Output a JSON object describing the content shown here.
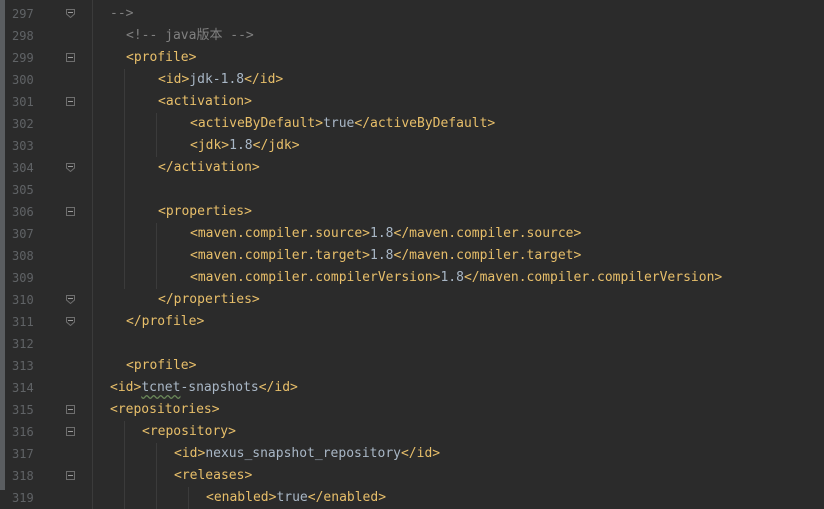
{
  "editor": {
    "lines": [
      {
        "num": "297",
        "parts": [
          {
            "t": "-->",
            "c": "cmt"
          }
        ],
        "indent": 110,
        "fold": "end"
      },
      {
        "num": "298",
        "parts": [
          {
            "t": "<!-- java版本 -->",
            "c": "cmt"
          }
        ],
        "indent": 126,
        "fold": ""
      },
      {
        "num": "299",
        "parts": [
          {
            "t": "<profile>",
            "c": "tag"
          }
        ],
        "indent": 126,
        "fold": "start"
      },
      {
        "num": "300",
        "parts": [
          {
            "t": "<id>",
            "c": "tag"
          },
          {
            "t": "jdk-1.8",
            "c": "txt"
          },
          {
            "t": "</id>",
            "c": "tag"
          }
        ],
        "indent": 158,
        "fold": ""
      },
      {
        "num": "301",
        "parts": [
          {
            "t": "<activation>",
            "c": "tag"
          }
        ],
        "indent": 158,
        "fold": "start"
      },
      {
        "num": "302",
        "parts": [
          {
            "t": "<activeByDefault>",
            "c": "tag"
          },
          {
            "t": "true",
            "c": "txt"
          },
          {
            "t": "</activeByDefault>",
            "c": "tag"
          }
        ],
        "indent": 190,
        "fold": ""
      },
      {
        "num": "303",
        "parts": [
          {
            "t": "<jdk>",
            "c": "tag"
          },
          {
            "t": "1.8",
            "c": "txt"
          },
          {
            "t": "</jdk>",
            "c": "tag"
          }
        ],
        "indent": 190,
        "fold": ""
      },
      {
        "num": "304",
        "parts": [
          {
            "t": "</activation>",
            "c": "tag"
          }
        ],
        "indent": 158,
        "fold": "end"
      },
      {
        "num": "305",
        "parts": [],
        "indent": 158,
        "fold": ""
      },
      {
        "num": "306",
        "parts": [
          {
            "t": "<properties>",
            "c": "tag"
          }
        ],
        "indent": 158,
        "fold": "start"
      },
      {
        "num": "307",
        "parts": [
          {
            "t": "<maven.compiler.source>",
            "c": "tag"
          },
          {
            "t": "1.8",
            "c": "txt"
          },
          {
            "t": "</maven.compiler.source>",
            "c": "tag"
          }
        ],
        "indent": 190,
        "fold": ""
      },
      {
        "num": "308",
        "parts": [
          {
            "t": "<maven.compiler.target>",
            "c": "tag"
          },
          {
            "t": "1.8",
            "c": "txt"
          },
          {
            "t": "</maven.compiler.target>",
            "c": "tag"
          }
        ],
        "indent": 190,
        "fold": ""
      },
      {
        "num": "309",
        "parts": [
          {
            "t": "<maven.compiler.compilerVersion>",
            "c": "tag"
          },
          {
            "t": "1.8",
            "c": "txt"
          },
          {
            "t": "</maven.compiler.compilerVersion>",
            "c": "tag"
          }
        ],
        "indent": 190,
        "fold": ""
      },
      {
        "num": "310",
        "parts": [
          {
            "t": "</properties>",
            "c": "tag"
          }
        ],
        "indent": 158,
        "fold": "end"
      },
      {
        "num": "311",
        "parts": [
          {
            "t": "</profile>",
            "c": "tag"
          }
        ],
        "indent": 126,
        "fold": "end"
      },
      {
        "num": "312",
        "parts": [],
        "indent": 126,
        "fold": ""
      },
      {
        "num": "313",
        "parts": [
          {
            "t": "<profile>",
            "c": "tag"
          }
        ],
        "indent": 126,
        "fold": ""
      },
      {
        "num": "314",
        "parts": [
          {
            "t": "<id>",
            "c": "tag"
          },
          {
            "t": "tcnet",
            "c": "txt squig"
          },
          {
            "t": "-snapshots",
            "c": "txt"
          },
          {
            "t": "</id>",
            "c": "tag"
          }
        ],
        "indent": 110,
        "fold": ""
      },
      {
        "num": "315",
        "parts": [
          {
            "t": "<repositories>",
            "c": "tag"
          }
        ],
        "indent": 110,
        "fold": "start"
      },
      {
        "num": "316",
        "parts": [
          {
            "t": "<repository>",
            "c": "tag"
          }
        ],
        "indent": 142,
        "fold": "start"
      },
      {
        "num": "317",
        "parts": [
          {
            "t": "<id>",
            "c": "tag"
          },
          {
            "t": "nexus_snapshot_repository",
            "c": "txt"
          },
          {
            "t": "</id>",
            "c": "tag"
          }
        ],
        "indent": 174,
        "fold": ""
      },
      {
        "num": "318",
        "parts": [
          {
            "t": "<releases>",
            "c": "tag"
          }
        ],
        "indent": 174,
        "fold": "start"
      },
      {
        "num": "319",
        "parts": [
          {
            "t": "<enabled>",
            "c": "tag"
          },
          {
            "t": "true",
            "c": "txt"
          },
          {
            "t": "</enabled>",
            "c": "tag"
          }
        ],
        "indent": 206,
        "fold": ""
      }
    ]
  },
  "colors": {
    "background": "#2b2b2b",
    "tag": "#e8bf6a",
    "text": "#a9b7c6",
    "comment": "#808080",
    "line_number": "#606366"
  }
}
